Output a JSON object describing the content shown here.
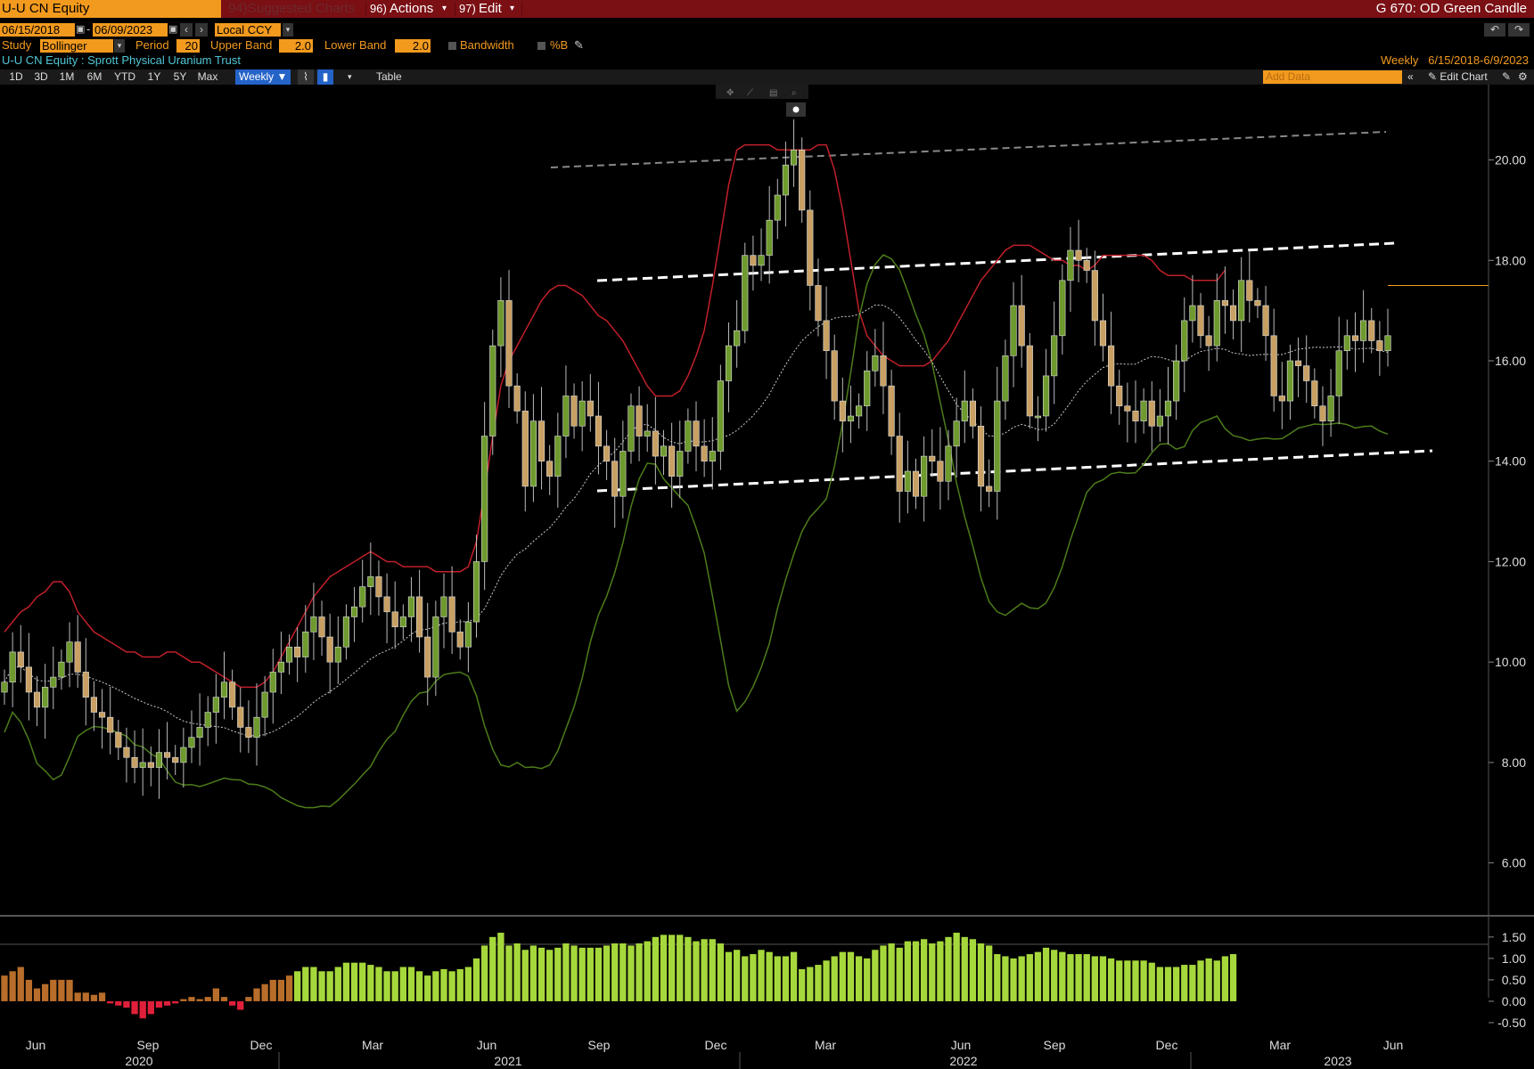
{
  "header": {
    "ticker": "U-U CN Equity",
    "suggested": "Suggested Charts",
    "suggested_num": "94)",
    "actions": "Actions",
    "actions_num": "96)",
    "edit": "Edit",
    "edit_num": "97)",
    "right_title": "G 670: OD Green Candle"
  },
  "controls": {
    "start_date": "06/15/2018",
    "end_date": "06/09/2023",
    "currency": "Local CCY",
    "study_label": "Study",
    "study_value": "Bollinger",
    "period_label": "Period",
    "period_value": "20",
    "upper_label": "Upper Band",
    "upper_value": "2.0",
    "lower_label": "Lower Band",
    "lower_value": "2.0",
    "bandwidth_label": "Bandwidth",
    "pctb_label": "%B"
  },
  "security": {
    "name": "U-U CN Equity : Sprott Physical Uranium Trust",
    "range_label": "Weekly   6/15/2018-6/9/2023"
  },
  "toolbar": {
    "periods": [
      "1D",
      "3D",
      "1M",
      "6M",
      "YTD",
      "1Y",
      "5Y",
      "Max"
    ],
    "frequency": "Weekly",
    "table": "Table",
    "add_data": "Add Data",
    "edit_chart": "Edit Chart"
  },
  "colors": {
    "up": "#6e9a2e",
    "down": "#c8a063",
    "upper_band": "#c0202a",
    "lower_band": "#4d7c1a",
    "mid_band": "#cccccc",
    "pctb_pos": "#a6d83c",
    "pctb_low": "#b86d2a",
    "pctb_neg": "#e0203a",
    "last_price_line": "#f29a1e"
  },
  "chart_data": [
    {
      "type": "candlestick",
      "frequency": "weekly",
      "ylim": [
        5.0,
        21.5
      ],
      "yticks": [
        "20.00",
        "18.00",
        "16.00",
        "14.00",
        "12.00",
        "10.00",
        "8.00",
        "6.00"
      ],
      "xticks": [
        "Jun",
        "Sep",
        "Dec",
        "Mar",
        "Jun",
        "Sep",
        "Dec",
        "Mar",
        "Jun",
        "Sep",
        "Dec",
        "Mar",
        "Jun"
      ],
      "years": [
        "2020",
        "2021",
        "2022",
        "2023"
      ],
      "grid": false,
      "close": [
        9.6,
        10.2,
        9.9,
        9.4,
        9.1,
        9.5,
        9.7,
        10.0,
        10.4,
        9.8,
        9.3,
        9.0,
        8.9,
        8.6,
        8.3,
        8.1,
        7.9,
        8.0,
        7.9,
        8.2,
        8.1,
        8.0,
        8.3,
        8.5,
        8.7,
        9.0,
        9.3,
        9.6,
        9.1,
        8.7,
        8.5,
        8.9,
        9.4,
        9.8,
        10.0,
        10.3,
        10.1,
        10.6,
        10.9,
        10.5,
        10.0,
        10.3,
        10.9,
        11.1,
        11.5,
        11.7,
        11.3,
        11.0,
        10.7,
        10.9,
        11.3,
        10.5,
        9.7,
        10.9,
        11.3,
        10.6,
        10.3,
        10.8,
        12.0,
        14.5,
        16.3,
        17.2,
        15.5,
        15.0,
        13.5,
        14.8,
        14.0,
        13.7,
        14.5,
        15.3,
        14.7,
        15.2,
        14.9,
        14.3,
        14.0,
        13.3,
        14.2,
        15.1,
        14.5,
        14.6,
        14.1,
        14.3,
        13.7,
        14.2,
        14.8,
        14.3,
        14.0,
        14.2,
        15.6,
        16.3,
        16.6,
        18.1,
        17.9,
        18.1,
        18.8,
        19.3,
        19.9,
        20.2,
        19.0,
        17.5,
        16.8,
        16.2,
        15.2,
        14.8,
        14.9,
        15.1,
        15.8,
        16.1,
        15.5,
        14.5,
        13.4,
        13.8,
        13.3,
        14.1,
        14.0,
        13.6,
        14.3,
        14.8,
        15.2,
        14.7,
        13.5,
        13.4,
        15.2,
        16.1,
        17.1,
        16.3,
        14.9,
        14.9,
        15.7,
        16.5,
        17.6,
        18.2,
        18.0,
        17.8,
        16.8,
        16.3,
        15.5,
        15.1,
        15.0,
        14.8,
        15.2,
        14.7,
        14.9,
        15.2,
        16.0,
        16.8,
        17.1,
        16.5,
        16.3,
        17.2,
        17.1,
        16.8,
        17.6,
        17.2,
        17.1,
        16.5,
        15.3,
        15.2,
        16.0,
        15.9,
        15.6,
        15.1,
        14.8,
        15.3,
        16.2,
        16.5,
        16.4,
        16.8,
        16.4,
        16.2,
        16.5
      ]
    },
    {
      "type": "line",
      "name": "Bollinger Bands",
      "upper": [
        10.6,
        10.8,
        11.0,
        11.1,
        11.3,
        11.4,
        11.6,
        11.6,
        11.4,
        11.0,
        10.8,
        10.6,
        10.5,
        10.4,
        10.3,
        10.2,
        10.2,
        10.1,
        10.1,
        10.1,
        10.2,
        10.2,
        10.1,
        10.0,
        10.0,
        9.9,
        9.8,
        9.7,
        9.6,
        9.5,
        9.5,
        9.5,
        9.6,
        9.8,
        10.1,
        10.4,
        10.7,
        11.0,
        11.3,
        11.5,
        11.7,
        11.8,
        11.9,
        12.0,
        12.1,
        12.2,
        12.1,
        12.0,
        12.0,
        11.9,
        11.9,
        11.9,
        11.9,
        11.8,
        11.8,
        11.8,
        11.8,
        11.9,
        12.4,
        13.4,
        14.5,
        15.5,
        16.0,
        16.3,
        16.6,
        16.9,
        17.2,
        17.4,
        17.5,
        17.5,
        17.4,
        17.3,
        17.1,
        16.9,
        16.8,
        16.6,
        16.4,
        16.1,
        15.8,
        15.5,
        15.3,
        15.3,
        15.3,
        15.4,
        15.7,
        16.1,
        16.6,
        17.5,
        18.5,
        19.5,
        20.2,
        20.3,
        20.3,
        20.3,
        20.3,
        20.2,
        20.2,
        20.2,
        20.2,
        20.2,
        20.3,
        20.3,
        19.8,
        19.0,
        18.0,
        17.0,
        16.5,
        16.3,
        16.1,
        16.0,
        15.9,
        15.9,
        15.9,
        15.9,
        16.0,
        16.2,
        16.4,
        16.7,
        17.0,
        17.3,
        17.6,
        17.8,
        18.0,
        18.2,
        18.3,
        18.3,
        18.3,
        18.2,
        18.1,
        18.0,
        18.0,
        17.9,
        17.9,
        17.8,
        17.9,
        18.1,
        18.1,
        18.1,
        18.1,
        18.1,
        18.1,
        18.0,
        17.8,
        17.7,
        17.7,
        17.7,
        17.6,
        17.6,
        17.6,
        17.6,
        17.8
      ]
    },
    {
      "type": "bar",
      "name": "%B",
      "ylim": [
        -0.75,
        1.85
      ],
      "yticks": [
        "1.50",
        "1.00",
        "0.50",
        "0.00",
        "-0.50"
      ],
      "values": [
        0.6,
        0.7,
        0.8,
        0.5,
        0.3,
        0.4,
        0.5,
        0.5,
        0.5,
        0.2,
        0.2,
        0.15,
        0.2,
        -0.05,
        -0.1,
        -0.15,
        -0.3,
        -0.4,
        -0.3,
        -0.15,
        -0.1,
        -0.05,
        0.05,
        0.1,
        0.05,
        0.1,
        0.3,
        0.1,
        -0.1,
        -0.2,
        0.1,
        0.3,
        0.4,
        0.5,
        0.5,
        0.6,
        0.7,
        0.8,
        0.8,
        0.7,
        0.7,
        0.8,
        0.9,
        0.9,
        0.9,
        0.85,
        0.8,
        0.7,
        0.7,
        0.8,
        0.8,
        0.7,
        0.6,
        0.7,
        0.75,
        0.7,
        0.75,
        0.8,
        1.0,
        1.3,
        1.5,
        1.6,
        1.3,
        1.35,
        1.2,
        1.3,
        1.25,
        1.2,
        1.25,
        1.35,
        1.3,
        1.25,
        1.25,
        1.25,
        1.3,
        1.35,
        1.35,
        1.3,
        1.35,
        1.4,
        1.5,
        1.55,
        1.55,
        1.55,
        1.5,
        1.4,
        1.45,
        1.45,
        1.35,
        1.15,
        1.2,
        1.05,
        1.1,
        1.2,
        1.15,
        1.05,
        1.05,
        1.15,
        0.75,
        0.8,
        0.85,
        0.95,
        1.05,
        1.15,
        1.15,
        1.05,
        1.0,
        1.2,
        1.3,
        1.35,
        1.25,
        1.4,
        1.4,
        1.45,
        1.35,
        1.4,
        1.5,
        1.6,
        1.5,
        1.45,
        1.35,
        1.3,
        1.1,
        1.05,
        1.0,
        1.05,
        1.1,
        1.15,
        1.25,
        1.2,
        1.15,
        1.1,
        1.1,
        1.1,
        1.05,
        1.05,
        1.0,
        0.95,
        0.95,
        0.95,
        0.95,
        0.9,
        0.8,
        0.8,
        0.8,
        0.85,
        0.85,
        0.95,
        1.0,
        0.95,
        1.05,
        1.1
      ]
    }
  ]
}
